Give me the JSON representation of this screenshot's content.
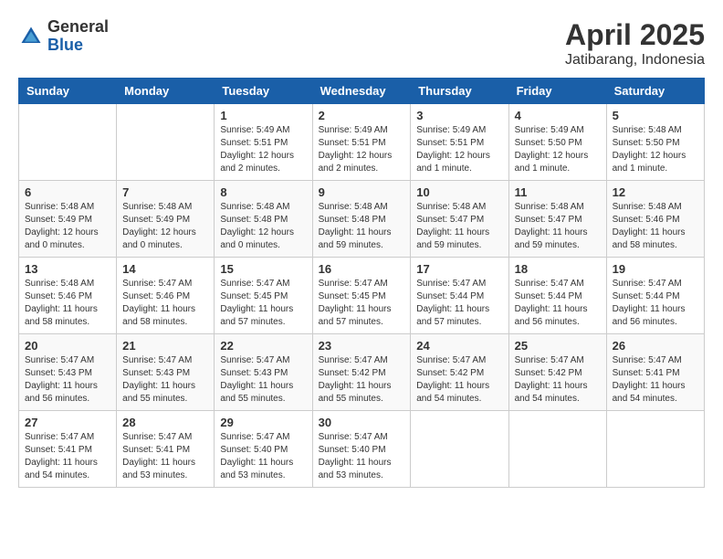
{
  "logo": {
    "general": "General",
    "blue": "Blue"
  },
  "title": "April 2025",
  "location": "Jatibarang, Indonesia",
  "days_header": [
    "Sunday",
    "Monday",
    "Tuesday",
    "Wednesday",
    "Thursday",
    "Friday",
    "Saturday"
  ],
  "weeks": [
    [
      {
        "day": "",
        "info": ""
      },
      {
        "day": "",
        "info": ""
      },
      {
        "day": "1",
        "info": "Sunrise: 5:49 AM\nSunset: 5:51 PM\nDaylight: 12 hours and 2 minutes."
      },
      {
        "day": "2",
        "info": "Sunrise: 5:49 AM\nSunset: 5:51 PM\nDaylight: 12 hours and 2 minutes."
      },
      {
        "day": "3",
        "info": "Sunrise: 5:49 AM\nSunset: 5:51 PM\nDaylight: 12 hours and 1 minute."
      },
      {
        "day": "4",
        "info": "Sunrise: 5:49 AM\nSunset: 5:50 PM\nDaylight: 12 hours and 1 minute."
      },
      {
        "day": "5",
        "info": "Sunrise: 5:48 AM\nSunset: 5:50 PM\nDaylight: 12 hours and 1 minute."
      }
    ],
    [
      {
        "day": "6",
        "info": "Sunrise: 5:48 AM\nSunset: 5:49 PM\nDaylight: 12 hours and 0 minutes."
      },
      {
        "day": "7",
        "info": "Sunrise: 5:48 AM\nSunset: 5:49 PM\nDaylight: 12 hours and 0 minutes."
      },
      {
        "day": "8",
        "info": "Sunrise: 5:48 AM\nSunset: 5:48 PM\nDaylight: 12 hours and 0 minutes."
      },
      {
        "day": "9",
        "info": "Sunrise: 5:48 AM\nSunset: 5:48 PM\nDaylight: 11 hours and 59 minutes."
      },
      {
        "day": "10",
        "info": "Sunrise: 5:48 AM\nSunset: 5:47 PM\nDaylight: 11 hours and 59 minutes."
      },
      {
        "day": "11",
        "info": "Sunrise: 5:48 AM\nSunset: 5:47 PM\nDaylight: 11 hours and 59 minutes."
      },
      {
        "day": "12",
        "info": "Sunrise: 5:48 AM\nSunset: 5:46 PM\nDaylight: 11 hours and 58 minutes."
      }
    ],
    [
      {
        "day": "13",
        "info": "Sunrise: 5:48 AM\nSunset: 5:46 PM\nDaylight: 11 hours and 58 minutes."
      },
      {
        "day": "14",
        "info": "Sunrise: 5:47 AM\nSunset: 5:46 PM\nDaylight: 11 hours and 58 minutes."
      },
      {
        "day": "15",
        "info": "Sunrise: 5:47 AM\nSunset: 5:45 PM\nDaylight: 11 hours and 57 minutes."
      },
      {
        "day": "16",
        "info": "Sunrise: 5:47 AM\nSunset: 5:45 PM\nDaylight: 11 hours and 57 minutes."
      },
      {
        "day": "17",
        "info": "Sunrise: 5:47 AM\nSunset: 5:44 PM\nDaylight: 11 hours and 57 minutes."
      },
      {
        "day": "18",
        "info": "Sunrise: 5:47 AM\nSunset: 5:44 PM\nDaylight: 11 hours and 56 minutes."
      },
      {
        "day": "19",
        "info": "Sunrise: 5:47 AM\nSunset: 5:44 PM\nDaylight: 11 hours and 56 minutes."
      }
    ],
    [
      {
        "day": "20",
        "info": "Sunrise: 5:47 AM\nSunset: 5:43 PM\nDaylight: 11 hours and 56 minutes."
      },
      {
        "day": "21",
        "info": "Sunrise: 5:47 AM\nSunset: 5:43 PM\nDaylight: 11 hours and 55 minutes."
      },
      {
        "day": "22",
        "info": "Sunrise: 5:47 AM\nSunset: 5:43 PM\nDaylight: 11 hours and 55 minutes."
      },
      {
        "day": "23",
        "info": "Sunrise: 5:47 AM\nSunset: 5:42 PM\nDaylight: 11 hours and 55 minutes."
      },
      {
        "day": "24",
        "info": "Sunrise: 5:47 AM\nSunset: 5:42 PM\nDaylight: 11 hours and 54 minutes."
      },
      {
        "day": "25",
        "info": "Sunrise: 5:47 AM\nSunset: 5:42 PM\nDaylight: 11 hours and 54 minutes."
      },
      {
        "day": "26",
        "info": "Sunrise: 5:47 AM\nSunset: 5:41 PM\nDaylight: 11 hours and 54 minutes."
      }
    ],
    [
      {
        "day": "27",
        "info": "Sunrise: 5:47 AM\nSunset: 5:41 PM\nDaylight: 11 hours and 54 minutes."
      },
      {
        "day": "28",
        "info": "Sunrise: 5:47 AM\nSunset: 5:41 PM\nDaylight: 11 hours and 53 minutes."
      },
      {
        "day": "29",
        "info": "Sunrise: 5:47 AM\nSunset: 5:40 PM\nDaylight: 11 hours and 53 minutes."
      },
      {
        "day": "30",
        "info": "Sunrise: 5:47 AM\nSunset: 5:40 PM\nDaylight: 11 hours and 53 minutes."
      },
      {
        "day": "",
        "info": ""
      },
      {
        "day": "",
        "info": ""
      },
      {
        "day": "",
        "info": ""
      }
    ]
  ]
}
